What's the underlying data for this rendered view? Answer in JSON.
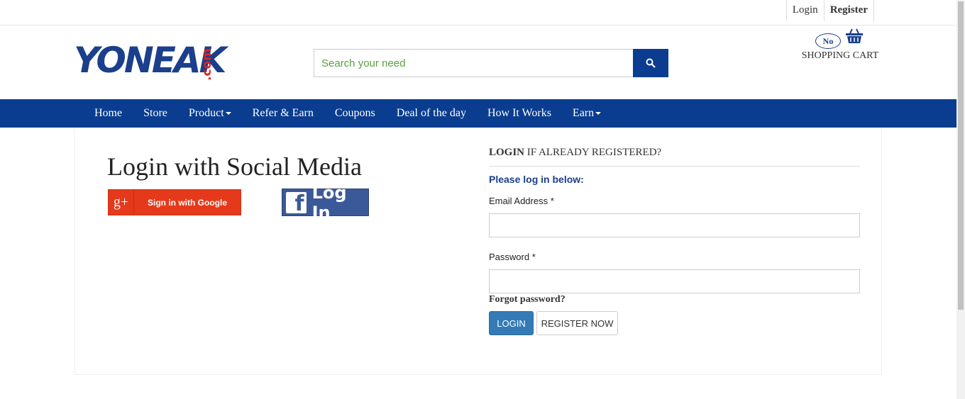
{
  "topbar": {
    "login": "Login",
    "register": "Register"
  },
  "logo": {
    "main": "YONEAK",
    "suffix": ".com"
  },
  "search": {
    "placeholder": "Search your need"
  },
  "cart": {
    "badge": "No",
    "label": "SHOPPING CART"
  },
  "nav": {
    "items": [
      "Home",
      "Store",
      "Product",
      "Refer & Earn",
      "Coupons",
      "Deal of the day",
      "How It Works",
      "Earn"
    ]
  },
  "social": {
    "title": "Login with Social Media",
    "google_label": "Sign in with Google",
    "google_icon": "g+",
    "facebook_label": "Log In"
  },
  "login": {
    "heading_bold": "LOGIN",
    "heading_rest": " IF ALREADY REGISTERED?",
    "subheading": "Please log in below:",
    "email_label": "Email Address *",
    "password_label": "Password *",
    "forgot": "Forgot password?",
    "login_button": "LOGIN",
    "register_button": "REGISTER NOW"
  },
  "colors": {
    "brand_blue": "#0a3d8f",
    "brand_red": "#e2231a",
    "google_red": "#e5391b",
    "facebook_blue": "#3b5998"
  }
}
